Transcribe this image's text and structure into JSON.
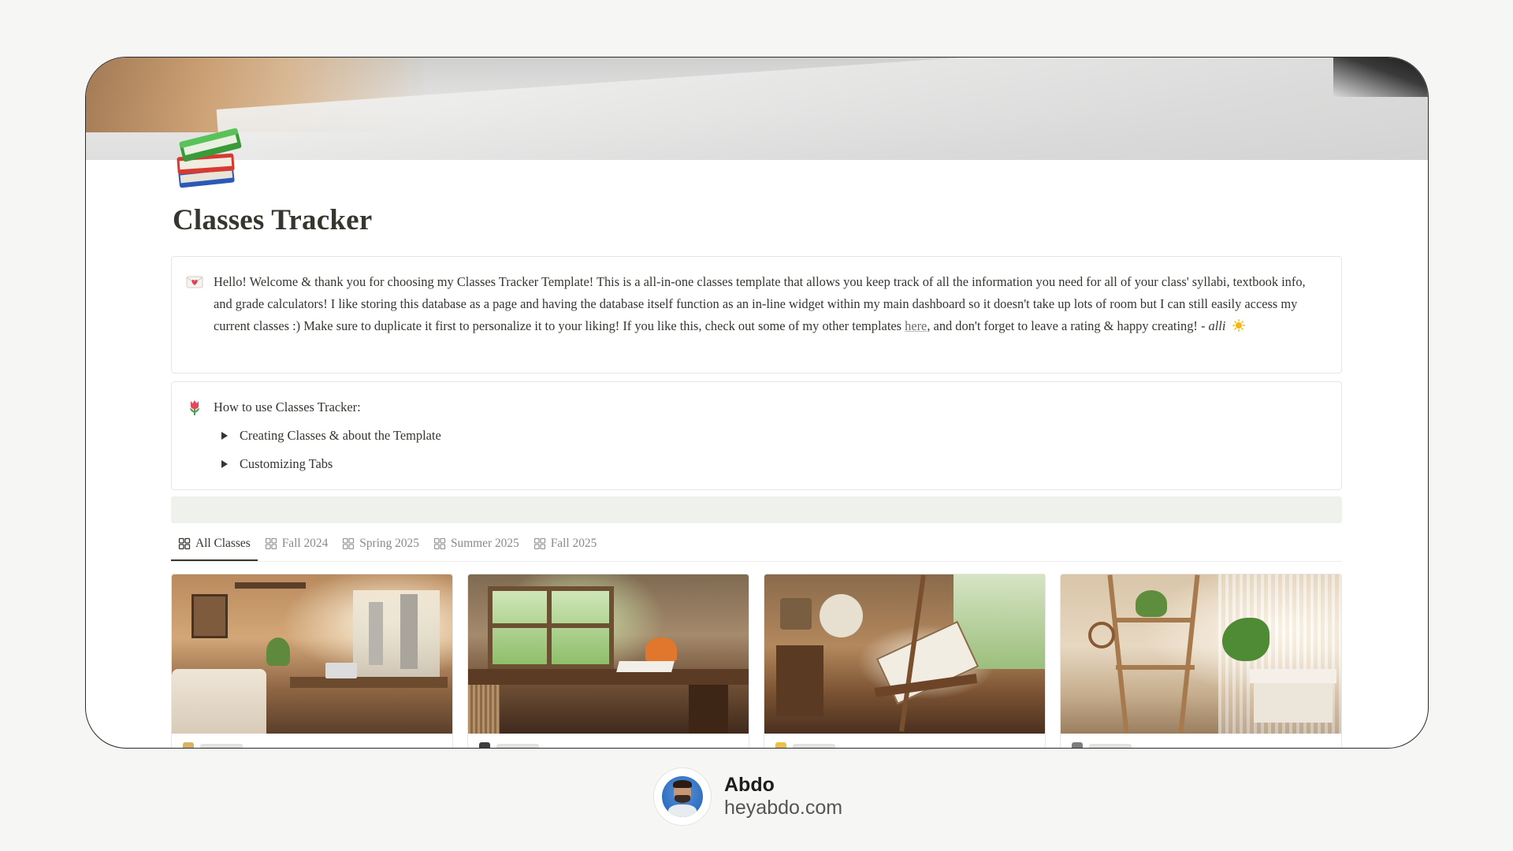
{
  "page": {
    "title": "Classes Tracker"
  },
  "welcome_callout": {
    "icon": "love-letter-icon",
    "text": "Hello! Welcome & thank you for choosing my Classes Tracker Template! This is a all-in-one classes template that allows you keep track of all the information you need for all of your class' syllabi, textbook info, and grade calculators! I like storing this database as a page and having the database itself function as an in-line widget within my main dashboard so it doesn't take up lots of room but I can still easily access my current classes :) Make sure to duplicate it first to personalize it to your liking! If you like this, check out some of my other templates ",
    "link_text": "here",
    "text_after_link": ", and don't forget to leave a rating & happy creating! - ",
    "signature": "alli"
  },
  "howto_callout": {
    "icon": "tulip-icon",
    "title": "How to use Classes Tracker:",
    "toggles": [
      {
        "label": "Creating Classes & about the Template"
      },
      {
        "label": "Customizing Tabs"
      }
    ]
  },
  "tabs": [
    {
      "label": "All Classes",
      "active": true
    },
    {
      "label": "Fall 2024",
      "active": false
    },
    {
      "label": "Spring 2025",
      "active": false
    },
    {
      "label": "Summer 2025",
      "active": false
    },
    {
      "label": "Fall 2025",
      "active": false
    }
  ],
  "cards": [
    {
      "scene": "cozy-bedroom-desk-photo"
    },
    {
      "scene": "wooden-desk-window-photo"
    },
    {
      "scene": "art-easel-studio-photo"
    },
    {
      "scene": "plant-shelf-desk-photo"
    }
  ],
  "brand": {
    "name": "Abdo",
    "site": "heyabdo.com"
  }
}
